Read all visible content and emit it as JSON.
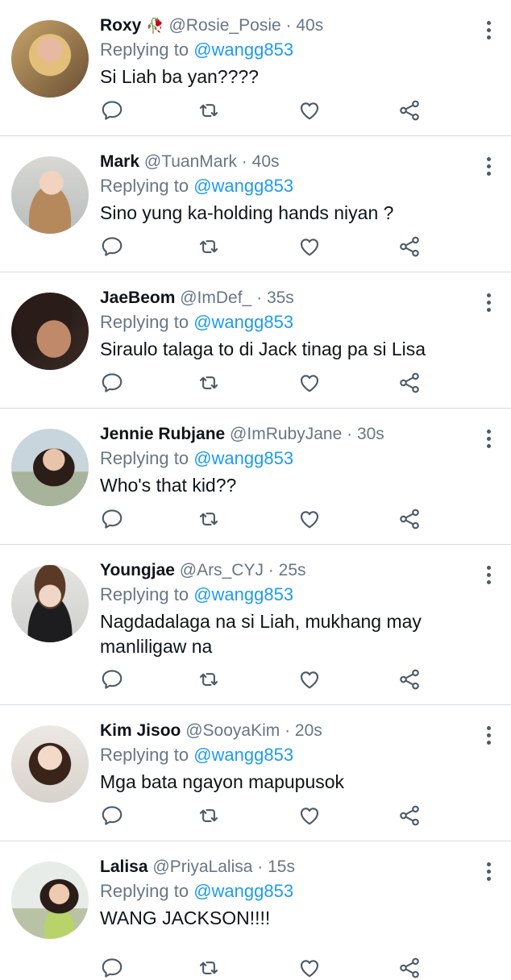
{
  "replying_label": "Replying to",
  "colors": {
    "accent": "#1d9bf0",
    "secondary_text": "#687684",
    "divider": "#d8dde1"
  },
  "tweets": [
    {
      "name": "Roxy",
      "emoji": "🥀",
      "handle": "@Rosie_Posie",
      "dot": "·",
      "time": "40s",
      "mention": "@wangg853",
      "text": "Si Liah ba yan????"
    },
    {
      "name": "Mark",
      "handle": "@TuanMark",
      "dot": "·",
      "time": "40s",
      "mention": "@wangg853",
      "text": "Sino yung ka-holding hands niyan ?"
    },
    {
      "name": "JaeBeom",
      "handle": "@ImDef_",
      "dot": "·",
      "time": "35s",
      "mention": "@wangg853",
      "text": "Siraulo talaga to di Jack tinag pa si Lisa"
    },
    {
      "name": "Jennie Rubjane",
      "handle": "@ImRubyJane",
      "dot": "·",
      "time": "30s",
      "mention": "@wangg853",
      "text": "Who's that kid??"
    },
    {
      "name": "Youngjae",
      "handle": "@Ars_CYJ",
      "dot": "·",
      "time": "25s",
      "mention": "@wangg853",
      "text": "Nagdadalaga na si Liah, mukhang may manliligaw na"
    },
    {
      "name": "Kim Jisoo",
      "handle": "@SooyaKim",
      "dot": "·",
      "time": "20s",
      "mention": "@wangg853",
      "text": "Mga bata ngayon mapupusok"
    },
    {
      "name": "Lalisa",
      "handle": "@PriyaLalisa",
      "dot": "·",
      "time": "15s",
      "mention": "@wangg853",
      "text": "WANG JACKSON!!!!"
    }
  ]
}
